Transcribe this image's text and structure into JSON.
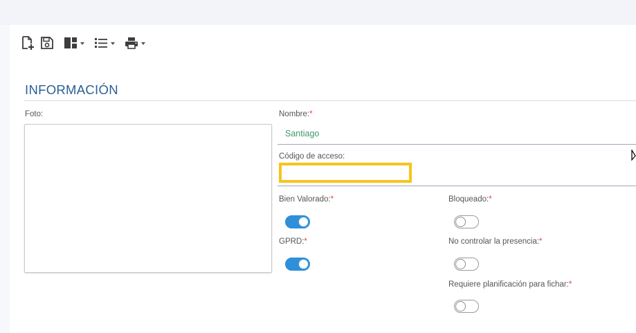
{
  "toolbar": {
    "buttons": [
      {
        "icon": "new-document-icon"
      },
      {
        "icon": "save-icon"
      },
      {
        "icon": "layout-icon",
        "dropdown": true
      },
      {
        "icon": "list-icon",
        "dropdown": true
      },
      {
        "icon": "print-icon",
        "dropdown": true
      }
    ]
  },
  "section": {
    "title": "INFORMACIÓN"
  },
  "photo": {
    "label": "Foto:"
  },
  "name": {
    "label": "Nombre:",
    "required_mark": "*",
    "value": "Santiago"
  },
  "access_code": {
    "label": "Código de acceso:",
    "value": "",
    "placeholder": ""
  },
  "toggles": {
    "bien_valorado": {
      "label": "Bien Valorado:",
      "required_mark": "*",
      "on": true
    },
    "gprd": {
      "label": "GPRD:",
      "required_mark": "*",
      "on": true
    },
    "bloqueado": {
      "label": "Bloqueado:",
      "required_mark": "*",
      "on": false
    },
    "no_controlar_presencia": {
      "label": "No controlar la presencia:",
      "required_mark": "*",
      "on": false
    },
    "requiere_planificacion": {
      "label": "Requiere planificación para fichar:",
      "required_mark": "*",
      "on": false
    }
  },
  "colors": {
    "accent": "#2b5f94",
    "toggle_on": "#2f8fd8",
    "name_value": "#3f9a6e",
    "required": "#e0453c",
    "focus_highlight": "#f7c41b"
  }
}
